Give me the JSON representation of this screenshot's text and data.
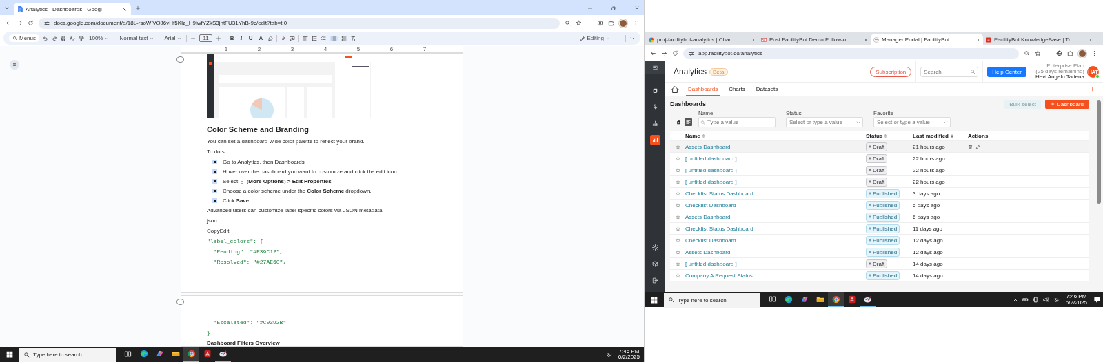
{
  "left_window": {
    "tab": {
      "title": "Analytics - Dashboards - Googl",
      "selected": true
    },
    "address": "docs.google.com/document/d/18L-rsoWiVOJ6vHf5KIz_H9iwfYZkS3jntFU31YhB-9c/edit?tab=t.0",
    "toolbar": {
      "menus": "Menus",
      "zoom": "100%",
      "style": "Normal text",
      "font": "Arial",
      "font_size": "11",
      "format": [
        "B",
        "I",
        "U",
        "A"
      ],
      "bullet_list_selected": true,
      "mode": "Editing"
    },
    "ruler": [
      "1",
      "2",
      "3",
      "4",
      "5",
      "6",
      "7"
    ],
    "pages": [
      {
        "blocks": [
          {
            "kind": "screenshot"
          },
          {
            "kind": "heading",
            "text": "Color Scheme and Branding"
          },
          {
            "kind": "paragraph",
            "text": "You can set a dashboard-wide color palette to reflect your brand."
          },
          {
            "kind": "paragraph",
            "text": "To do so:"
          },
          {
            "kind": "bullet",
            "text": "Go to Analytics, then Dashboards",
            "selected": true
          },
          {
            "kind": "bullet",
            "text": "Hover over the dashboard you want to customize and click the edit icon",
            "selected": true
          },
          {
            "kind": "bullet",
            "text": "Select ⋮ **(More Options) > Edit Properties**.",
            "selected": true
          },
          {
            "kind": "bullet",
            "text": "Choose a color scheme under the **Color Scheme** dropdown.",
            "selected": true
          },
          {
            "kind": "bullet",
            "text": "Click **Save**.",
            "selected": true
          },
          {
            "kind": "paragraph",
            "text": "Advanced users can customize label-specific colors via JSON metadata:"
          },
          {
            "kind": "paragraph",
            "text": "json"
          },
          {
            "kind": "paragraph",
            "text": "CopyEdit"
          },
          {
            "kind": "code",
            "text": "\"label_colors\": {"
          },
          {
            "kind": "code",
            "text": "  \"Pending\": \"#F39C12\","
          },
          {
            "kind": "code",
            "text": "  \"Resolved\": \"#27AE60\","
          }
        ]
      },
      {
        "blocks": [
          {
            "kind": "code",
            "text": "  \"Escalated\": \"#C0392B\""
          },
          {
            "kind": "code",
            "text": "}"
          },
          {
            "kind": "subheading",
            "text": "Dashboard Filters Overview"
          }
        ]
      }
    ],
    "taskbar": {
      "placeholder": "Type here to search",
      "time": "7:46 PM",
      "date": "6/2/2025",
      "notifications": false,
      "apps": [
        {
          "kind": "task-view",
          "selected": false,
          "open": false
        },
        {
          "kind": "edge",
          "selected": false,
          "open": false
        },
        {
          "kind": "copilot",
          "selected": false,
          "open": false
        },
        {
          "kind": "files",
          "selected": false,
          "open": false
        },
        {
          "kind": "chrome",
          "selected": true,
          "open": true
        },
        {
          "kind": "pdf",
          "selected": false,
          "open": false
        },
        {
          "kind": "paint",
          "selected": false,
          "open": true
        }
      ],
      "tray": [
        {
          "kind": "network"
        }
      ]
    }
  },
  "right_window": {
    "tabs": [
      {
        "title": "proj-facilitybot-analytics | Char",
        "kind": "pinwheel",
        "selected": false
      },
      {
        "title": "Post FacilityBot Demo Follow-u",
        "kind": "mail",
        "selected": false
      },
      {
        "title": "Manager Portal | FacilityBot",
        "kind": "bot",
        "selected": true
      },
      {
        "title": "FacilityBot KnowledgeBase | Tr",
        "kind": "doc",
        "selected": false
      }
    ],
    "address": "app.facilitybot.co/analytics",
    "app": {
      "title": "Analytics",
      "badge": "Beta",
      "subscription": "Subscription",
      "search_placeholder": "Search",
      "help": "Help Center",
      "plan": "Enterprise Plan",
      "plan_note": "(25 days remaining)",
      "user": "Hevi Angelo Tadena",
      "avatar": "HAT",
      "online": true,
      "sidebar": [
        {
          "kind": "grid",
          "selected": false
        },
        {
          "kind": "pin",
          "selected": false
        },
        {
          "kind": "tree",
          "selected": false
        },
        {
          "kind": "analytics",
          "selected": true
        },
        {
          "kind": "gear",
          "selected": false
        },
        {
          "kind": "cube",
          "selected": false
        },
        {
          "kind": "exit",
          "selected": false
        }
      ],
      "nav_tabs": [
        {
          "label": "Dashboards",
          "selected": true
        },
        {
          "label": "Charts",
          "selected": false
        },
        {
          "label": "Datasets",
          "selected": false
        }
      ],
      "section_title": "Dashboards",
      "bulk_select": "Bulk select",
      "new_button": "Dashboard",
      "views": [
        {
          "kind": "grid",
          "selected": false
        },
        {
          "kind": "list",
          "selected": true
        }
      ],
      "filters": [
        {
          "label": "Name",
          "placeholder": "Type a value",
          "kind": "search"
        },
        {
          "label": "Status",
          "placeholder": "Select or type a value",
          "kind": "select"
        },
        {
          "label": "Favorite",
          "placeholder": "Select or type a value",
          "kind": "select"
        }
      ],
      "columns": [
        {
          "label": "Name",
          "sortable": true,
          "sorted_descending": false
        },
        {
          "label": "Status",
          "sortable": true,
          "sorted_descending": false
        },
        {
          "label": "Last modified",
          "sortable": false,
          "sorted_descending": true
        },
        {
          "label": "Actions",
          "sortable": false,
          "sorted_descending": false
        }
      ],
      "rows": [
        {
          "name": "Assets Dashboard",
          "status": "Draft",
          "kind": "draft",
          "modified": "21 hours ago",
          "hovered": true
        },
        {
          "name": "[ untitled dashboard ]",
          "status": "Draft",
          "kind": "draft",
          "modified": "22 hours ago",
          "hovered": false
        },
        {
          "name": "[ untitled dashboard ]",
          "status": "Draft",
          "kind": "draft",
          "modified": "22 hours ago",
          "hovered": false
        },
        {
          "name": "[ untitled dashboard ]",
          "status": "Draft",
          "kind": "draft",
          "modified": "22 hours ago",
          "hovered": false
        },
        {
          "name": "Checklist Status Dashboard",
          "status": "Published",
          "kind": "published",
          "modified": "3 days ago",
          "hovered": false
        },
        {
          "name": "Checklist Dashboard",
          "status": "Published",
          "kind": "published",
          "modified": "5 days ago",
          "hovered": false
        },
        {
          "name": "Assets Dashboard",
          "status": "Published",
          "kind": "published",
          "modified": "6 days ago",
          "hovered": false
        },
        {
          "name": "Checklist Status Dashboard",
          "status": "Published",
          "kind": "published",
          "modified": "11 days ago",
          "hovered": false
        },
        {
          "name": "Checklist Dashboard",
          "status": "Published",
          "kind": "published",
          "modified": "12 days ago",
          "hovered": false
        },
        {
          "name": "Assets Dashboard",
          "status": "Published",
          "kind": "published",
          "modified": "12 days ago",
          "hovered": false
        },
        {
          "name": "[ untitled dashboard ]",
          "status": "Draft",
          "kind": "draft",
          "modified": "14 days ago",
          "hovered": false
        },
        {
          "name": "Company A Request Status",
          "status": "Published",
          "kind": "published",
          "modified": "14 days ago",
          "hovered": false
        }
      ]
    },
    "taskbar": {
      "placeholder": "Type here to search",
      "time": "7:46 PM",
      "date": "6/2/2025",
      "notifications": true,
      "apps": [
        {
          "kind": "task-view",
          "selected": false,
          "open": false
        },
        {
          "kind": "edge",
          "selected": false,
          "open": false
        },
        {
          "kind": "copilot",
          "selected": false,
          "open": false
        },
        {
          "kind": "files",
          "selected": false,
          "open": false
        },
        {
          "kind": "chrome",
          "selected": true,
          "open": true
        },
        {
          "kind": "pdf",
          "selected": false,
          "open": false
        },
        {
          "kind": "paint",
          "selected": false,
          "open": true
        }
      ],
      "tray": [
        {
          "kind": "chevron"
        },
        {
          "kind": "battery"
        },
        {
          "kind": "device"
        },
        {
          "kind": "volume"
        },
        {
          "kind": "network"
        }
      ]
    }
  }
}
